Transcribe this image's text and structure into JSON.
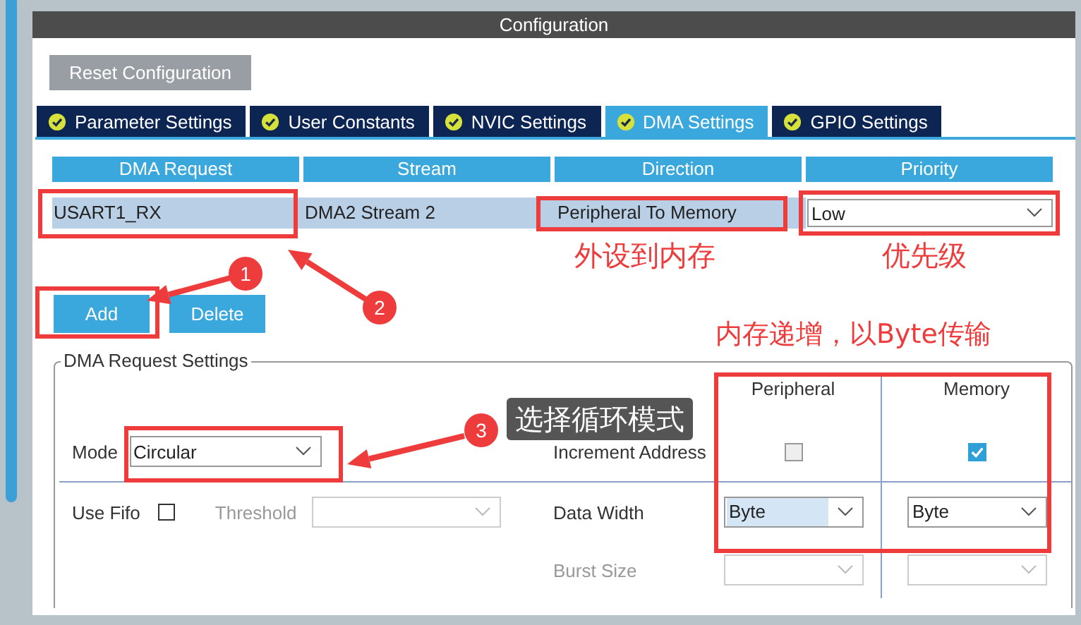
{
  "window": {
    "title": "Configuration"
  },
  "reset_button": "Reset Configuration",
  "tabs": [
    {
      "label": "Parameter Settings",
      "selected": false
    },
    {
      "label": "User Constants",
      "selected": false
    },
    {
      "label": "NVIC Settings",
      "selected": false
    },
    {
      "label": "DMA Settings",
      "selected": true
    },
    {
      "label": "GPIO Settings",
      "selected": false
    }
  ],
  "table": {
    "columns": [
      "DMA Request",
      "Stream",
      "Direction",
      "Priority"
    ],
    "rows": [
      {
        "dma_request": "USART1_RX",
        "stream": "DMA2 Stream 2",
        "direction": "Peripheral To Memory",
        "priority": "Low"
      }
    ]
  },
  "buttons": [
    "Add",
    "Delete"
  ],
  "settings": {
    "title": "DMA Request Settings",
    "columns": [
      "Peripheral",
      "Memory"
    ],
    "mode": {
      "label": "Mode",
      "value": "Circular"
    },
    "increment": {
      "label": "Increment Address",
      "peripheral_checked": false,
      "memory_checked": true
    },
    "use_fifo": {
      "label": "Use Fifo",
      "checked": false
    },
    "threshold": {
      "label": "Threshold",
      "disabled": true
    },
    "data_width": {
      "label": "Data Width",
      "values": [
        {
          "value": "Byte",
          "highlighted": true
        },
        {
          "value": "Byte",
          "highlighted": false
        }
      ]
    },
    "burst_size": {
      "label": "Burst Size",
      "disabled": true
    }
  },
  "annotations": {
    "badges": [
      "1",
      "2",
      "3"
    ],
    "notes": [
      "外设到内存",
      "优先级",
      "内存递增，以Byte传输"
    ],
    "tooltip": "选择循环模式"
  }
}
